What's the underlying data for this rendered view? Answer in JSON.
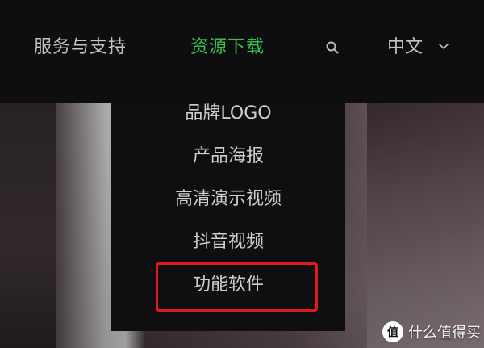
{
  "navbar": {
    "items": [
      {
        "label": "服务与支持"
      },
      {
        "label": "资源下载"
      }
    ],
    "language": {
      "label": "中文"
    }
  },
  "dropdown": {
    "items": [
      {
        "label": "品牌LOGO"
      },
      {
        "label": "产品海报"
      },
      {
        "label": "高清演示视频"
      },
      {
        "label": "抖音视频"
      },
      {
        "label": "功能软件"
      }
    ]
  },
  "watermark": {
    "logo_text": "值",
    "text": "什么值得买"
  },
  "colors": {
    "accent": "#36c14a",
    "highlight": "#e11b1b",
    "nav_bg": "#0e0e10"
  }
}
